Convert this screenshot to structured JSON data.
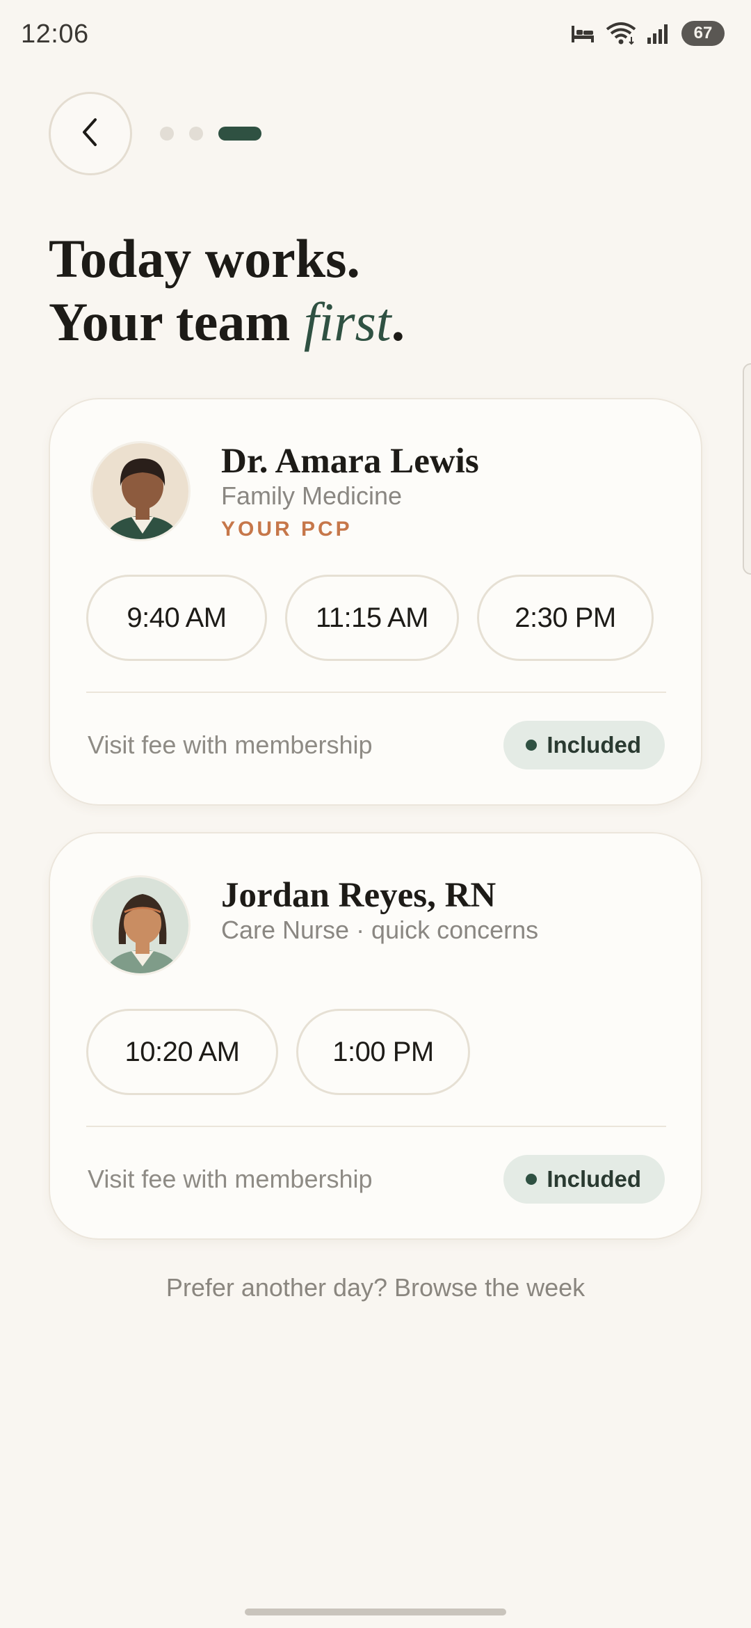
{
  "status_bar": {
    "time": "12:06",
    "battery": "67",
    "icons": [
      "bed-icon",
      "wifi-icon",
      "signal-icon",
      "battery-icon"
    ]
  },
  "nav": {
    "back_icon": "chevron-left-icon",
    "progress_steps": 3,
    "progress_current": 3
  },
  "headline": {
    "line1": "Today works.",
    "line2_prefix": "Your team ",
    "line2_emph": "first",
    "line2_suffix": "."
  },
  "providers": [
    {
      "name": "Dr. Amara Lewis",
      "specialty": "Family Medicine",
      "tag": "YOUR PCP",
      "slots": [
        "9:40 AM",
        "11:15 AM",
        "2:30 PM"
      ],
      "fee_label": "Visit fee with membership",
      "fee_badge": "Included"
    },
    {
      "name": "Jordan Reyes, RN",
      "specialty": "Care Nurse · quick concerns",
      "slots": [
        "10:20 AM",
        "1:00 PM"
      ],
      "fee_label": "Visit fee with membership",
      "fee_badge": "Included"
    }
  ],
  "browse_link": "Prefer another day? Browse the week",
  "colors": {
    "background": "#f9f6f1",
    "accent": "#2f5142",
    "tag": "#c6774a",
    "badge_bg": "#e4ebe5"
  }
}
